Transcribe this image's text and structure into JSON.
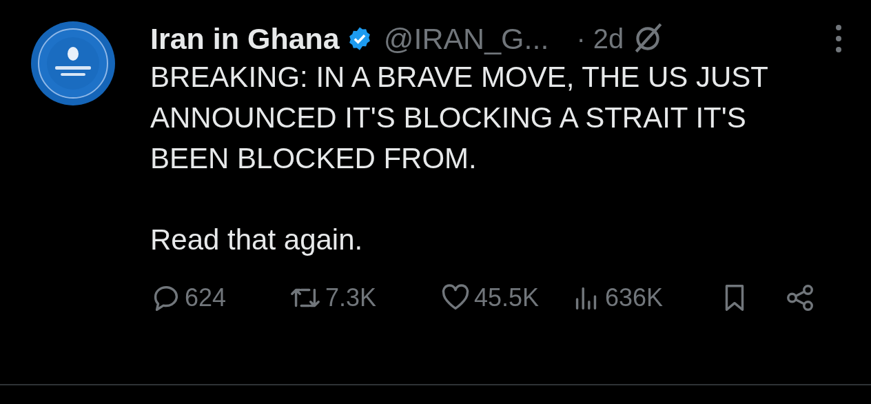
{
  "author": {
    "name": "Iran in Ghana",
    "verified": true,
    "handle": "@IRAN_G...",
    "separator": "·",
    "time": "2d"
  },
  "body": [
    "BREAKING: IN A BRAVE MOVE, THE US JUST ANNOUNCED IT'S BLOCKING A STRAIT IT'S BEEN BLOCKED FROM.",
    "Read that again."
  ],
  "actions": [
    {
      "kind": "reply",
      "count": "624"
    },
    {
      "kind": "repost",
      "count": "7.3K"
    },
    {
      "kind": "like",
      "count": "45.5K"
    },
    {
      "kind": "views",
      "count": "636K"
    },
    {
      "kind": "bookmark"
    },
    {
      "kind": "share"
    }
  ]
}
